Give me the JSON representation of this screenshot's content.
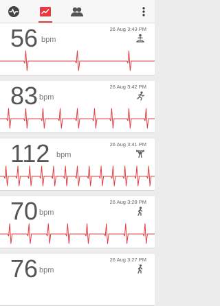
{
  "toolbar": {
    "tabs": [
      {
        "name": "heartbeat-tab",
        "icon": "pulse-icon",
        "active": false
      },
      {
        "name": "history-tab",
        "icon": "chart-icon",
        "active": true
      },
      {
        "name": "friends-tab",
        "icon": "people-icon",
        "active": false
      }
    ],
    "menu_icon": "overflow-menu-icon"
  },
  "colors": {
    "accent": "#e53a3f",
    "text": "#555555",
    "trace": "#e23c42"
  },
  "measurements": [
    {
      "bpm": "56",
      "unit": "bpm",
      "timestamp": "26 Aug 3:43 PM",
      "activity_icon": "meditate-icon"
    },
    {
      "bpm": "83",
      "unit": "bpm",
      "timestamp": "26 Aug 3:42 PM",
      "activity_icon": "run-icon"
    },
    {
      "bpm": "112",
      "unit": "bpm",
      "timestamp": "26 Aug 3:41 PM",
      "activity_icon": "weightlift-icon"
    },
    {
      "bpm": "70",
      "unit": "bpm",
      "timestamp": "26 Aug 3:28 PM",
      "activity_icon": "walk-icon"
    },
    {
      "bpm": "76",
      "unit": "bpm",
      "timestamp": "26 Aug 3:27 PM",
      "activity_icon": "walk-icon"
    }
  ]
}
